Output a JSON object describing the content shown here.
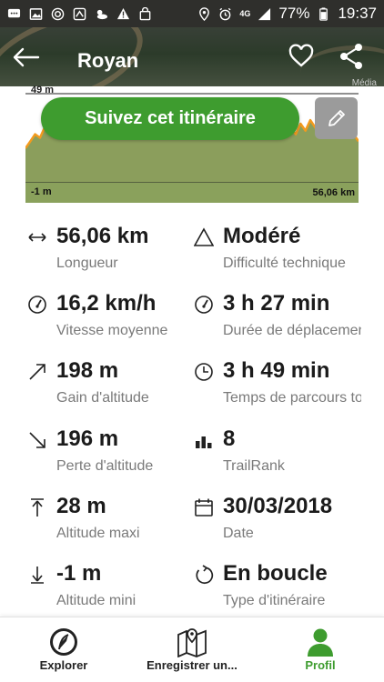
{
  "status_bar": {
    "signal": "4G",
    "battery": "77%",
    "time": "19:37"
  },
  "header": {
    "title": "Royan",
    "map_credit": "Média"
  },
  "elevation": {
    "max_label": "49 m",
    "min_label": "-1 m",
    "distance_label": "56,06 km",
    "follow_label": "Suivez cet itinéraire"
  },
  "chart_data": {
    "type": "area",
    "x_range": [
      0,
      56.06
    ],
    "y_range": [
      -1,
      49
    ],
    "x_unit": "km",
    "y_unit": "m",
    "y_values": [
      18,
      22,
      26,
      24,
      30,
      27,
      32,
      28,
      34,
      31,
      29,
      36,
      33,
      38,
      30,
      28,
      35,
      32,
      40,
      34,
      31,
      37,
      29,
      33,
      42,
      36,
      30,
      34,
      28,
      32,
      38,
      35,
      30,
      33,
      27,
      31,
      36,
      32,
      28,
      35,
      30,
      26,
      33,
      29,
      37,
      32,
      28,
      34,
      30,
      36,
      31,
      27,
      33,
      29,
      35,
      30,
      26,
      32,
      28,
      34,
      30,
      25,
      31,
      27,
      33,
      29,
      24,
      30,
      26,
      22
    ]
  },
  "stats": [
    {
      "icon": "distance-icon",
      "value": "56,06 km",
      "label": "Longueur"
    },
    {
      "icon": "difficulty-icon",
      "value": "Modéré",
      "label": "Difficulté technique"
    },
    {
      "icon": "speed-icon",
      "value": "16,2 km/h",
      "label": "Vitesse moyenne"
    },
    {
      "icon": "moving-time-icon",
      "value": "3 h 27 min",
      "label": "Durée de déplacement"
    },
    {
      "icon": "elevation-gain-icon",
      "value": "198 m",
      "label": "Gain d'altitude"
    },
    {
      "icon": "clock-icon",
      "value": "3 h 49 min",
      "label": "Temps de parcours total"
    },
    {
      "icon": "elevation-loss-icon",
      "value": "196 m",
      "label": "Perte d'altitude"
    },
    {
      "icon": "trailrank-icon",
      "value": "8",
      "label": "TrailRank"
    },
    {
      "icon": "max-altitude-icon",
      "value": "28 m",
      "label": "Altitude maxi"
    },
    {
      "icon": "calendar-icon",
      "value": "30/03/2018",
      "label": "Date"
    },
    {
      "icon": "min-altitude-icon",
      "value": "-1 m",
      "label": "Altitude mini"
    },
    {
      "icon": "loop-icon",
      "value": "En boucle",
      "label": "Type d'itinéraire"
    }
  ],
  "nav": {
    "explore": "Explorer",
    "record": "Enregistrer un...",
    "profile": "Profil"
  },
  "colors": {
    "accent_green": "#3e9c2f",
    "elevation_line": "#f39a1e",
    "elevation_fill": "#8b9e5c"
  }
}
